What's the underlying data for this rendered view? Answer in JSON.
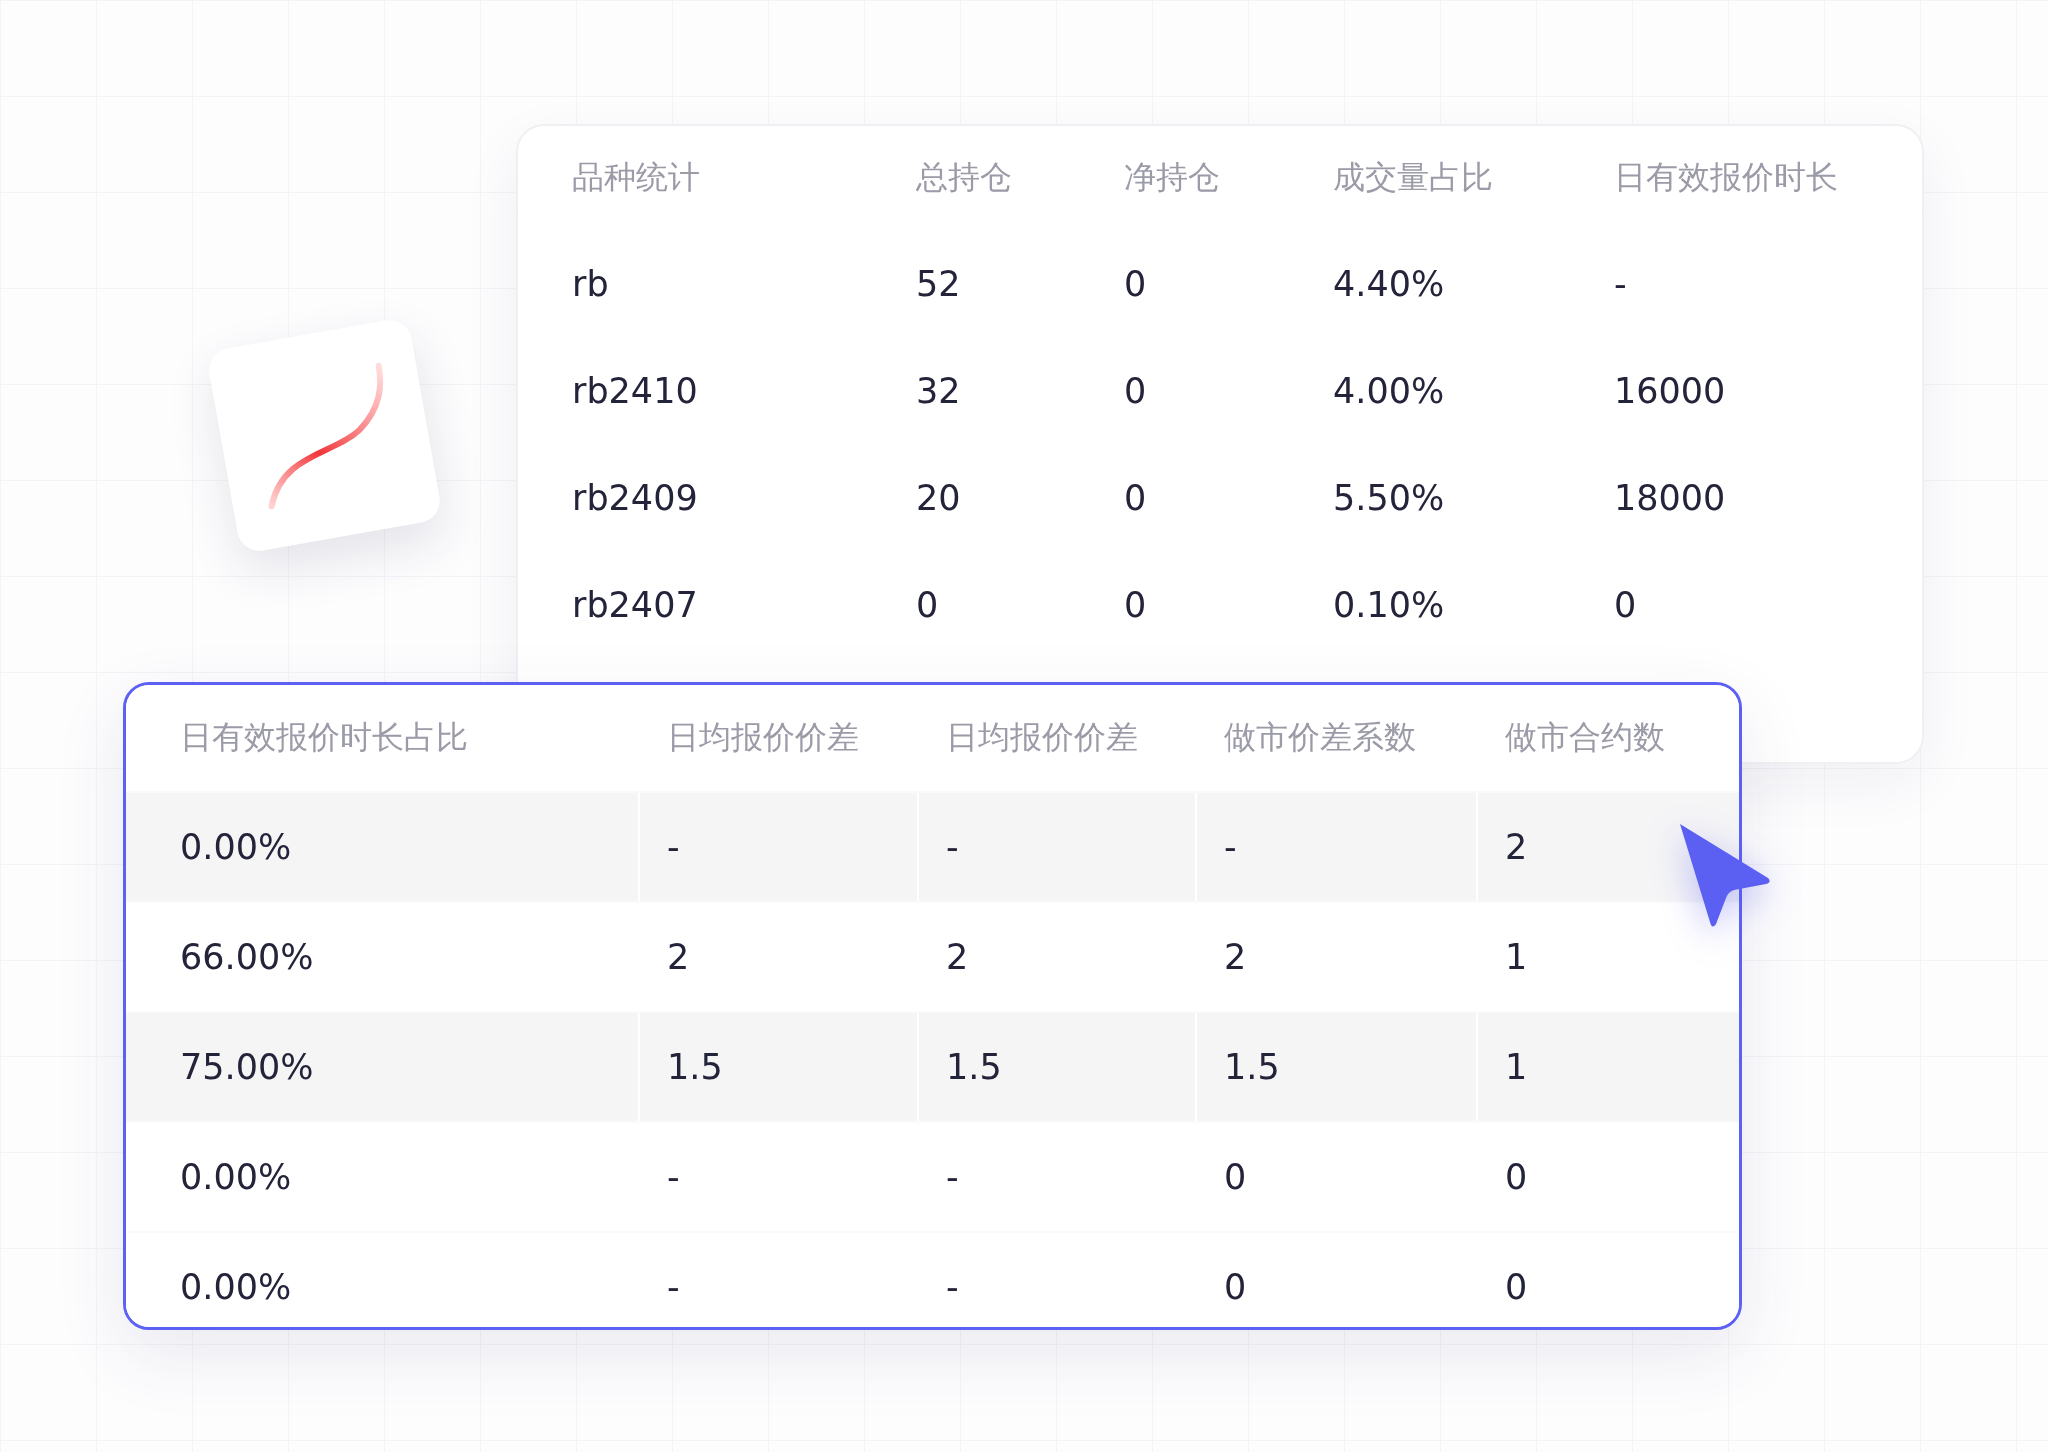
{
  "stats_table": {
    "columns": [
      "品种统计",
      "总持仓",
      "净持仓",
      "成交量占比",
      "日有效报价时长"
    ],
    "rows": [
      [
        "rb",
        "52",
        "0",
        "4.40%",
        "-"
      ],
      [
        "rb2410",
        "32",
        "0",
        "4.00%",
        "16000"
      ],
      [
        "rb2409",
        "20",
        "0",
        "5.50%",
        "18000"
      ],
      [
        "rb2407",
        "0",
        "0",
        "0.10%",
        "0"
      ]
    ]
  },
  "quote_table": {
    "columns": [
      "日有效报价时长占比",
      "日均报价价差",
      "日均报价价差",
      "做市价差系数",
      "做市合约数"
    ],
    "rows": [
      [
        "0.00%",
        "-",
        "-",
        "-",
        "2"
      ],
      [
        "66.00%",
        "2",
        "2",
        "2",
        "1"
      ],
      [
        "75.00%",
        "1.5",
        "1.5",
        "1.5",
        "1"
      ],
      [
        "0.00%",
        "-",
        "-",
        "0",
        "0"
      ],
      [
        "0.00%",
        "-",
        "-",
        "0",
        "0"
      ]
    ]
  }
}
